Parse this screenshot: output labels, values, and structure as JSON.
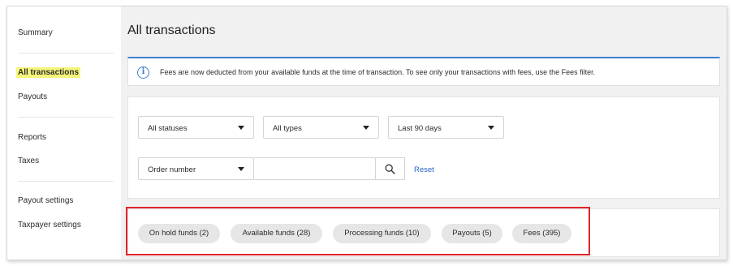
{
  "sidebar": {
    "items": [
      {
        "label": "Summary"
      },
      {
        "label": "All transactions",
        "active": true
      },
      {
        "label": "Payouts"
      },
      {
        "label": "Reports"
      },
      {
        "label": "Taxes"
      },
      {
        "label": "Payout settings"
      },
      {
        "label": "Taxpayer settings"
      }
    ]
  },
  "main": {
    "title": "All transactions",
    "banner": {
      "icon": "info-icon",
      "text": "Fees are now deducted from your available funds at the time of transaction. To see only your transactions with fees, use the Fees filter."
    },
    "filters": {
      "status": "All statuses",
      "type": "All types",
      "period": "Last 90 days",
      "search_field": "Order number",
      "search_value": "",
      "reset_label": "Reset"
    },
    "chips": [
      {
        "label": "On hold funds (2)"
      },
      {
        "label": "Available funds (28)"
      },
      {
        "label": "Processing funds (10)"
      },
      {
        "label": "Payouts (5)"
      },
      {
        "label": "Fees (395)"
      }
    ]
  },
  "colors": {
    "accent": "#3b7fd4",
    "link": "#2a62c9",
    "highlight_marker": "#f6f57a",
    "annotation_box": "#e0262a"
  }
}
